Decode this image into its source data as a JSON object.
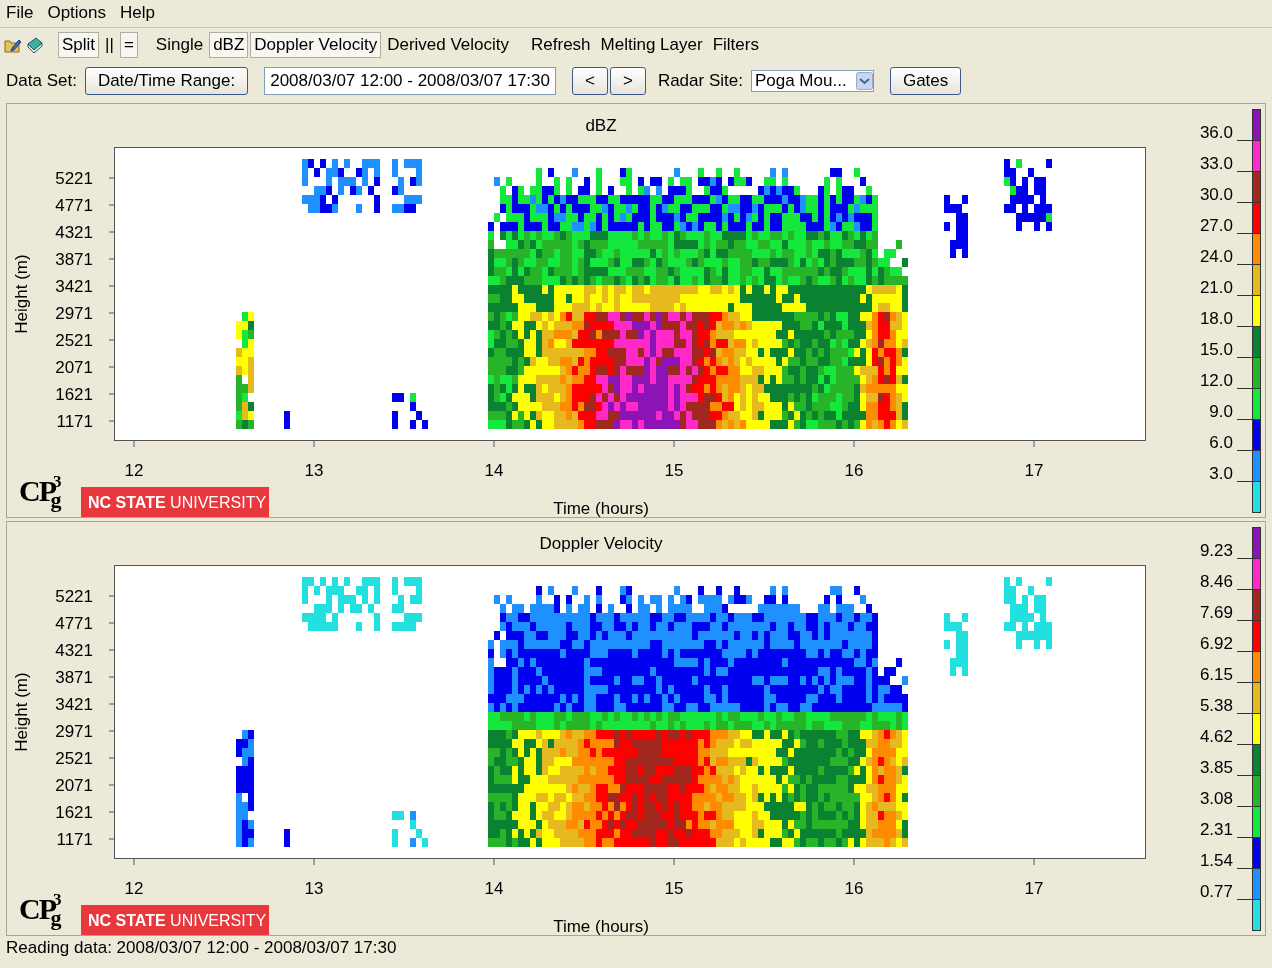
{
  "menu": [
    {
      "label": "File"
    },
    {
      "label": "Options"
    },
    {
      "label": "Help"
    }
  ],
  "toolbar": {
    "items": [
      {
        "label": "Split",
        "selected": true
      },
      {
        "label": "||",
        "selected": false
      },
      {
        "label": "=",
        "selected": true
      },
      {
        "label": "Single",
        "selected": false
      },
      {
        "label": "dBZ",
        "selected": true
      },
      {
        "label": "Doppler Velocity",
        "selected": true
      },
      {
        "label": "Derived Velocity",
        "selected": false
      },
      {
        "label": "Refresh",
        "selected": false
      },
      {
        "label": "Melting Layer",
        "selected": false
      },
      {
        "label": "Filters",
        "selected": false
      }
    ]
  },
  "dataset": {
    "label": "Data Set:",
    "range_button": "Date/Time Range:",
    "range_value": "2008/03/07 12:00 - 2008/03/07 17:30",
    "prev_button": "<",
    "next_button": ">",
    "site_label": "Radar Site:",
    "site_value": "Poga Mou...",
    "gates_button": "Gates"
  },
  "panels": [
    {
      "title": "dBZ",
      "kind": "reflectivity",
      "ylabel": "Height (m)",
      "yticks": [
        "5221",
        "4771",
        "4321",
        "3871",
        "3421",
        "2971",
        "2521",
        "2071",
        "1621",
        "1171"
      ],
      "xticks": [
        "12",
        "13",
        "14",
        "15",
        "16",
        "17"
      ],
      "xlabel": "Time (hours)",
      "logo": {
        "main": "CP",
        "sup": "3",
        "sub": "g"
      },
      "badge": {
        "bold": "NC STATE",
        "light": "UNIVERSITY"
      },
      "legend": {
        "labels": [
          "36.0",
          "33.0",
          "30.0",
          "27.0",
          "24.0",
          "21.0",
          "18.0",
          "15.0",
          "12.0",
          "9.0",
          "6.0",
          "3.0"
        ],
        "bands": [
          {
            "color": "#8c14b4"
          },
          {
            "color": "#ff28c8"
          },
          {
            "color": "#a0281e"
          },
          {
            "color": "#ff0000"
          },
          {
            "color": "#ff8c00"
          },
          {
            "color": "#e6b91e"
          },
          {
            "color": "#ffff00"
          },
          {
            "color": "#0a8232"
          },
          {
            "color": "#28b428"
          },
          {
            "color": "#14e83c"
          },
          {
            "color": "#0000f0"
          },
          {
            "color": "#1e90ff"
          },
          {
            "color": "#22e0e0"
          }
        ]
      }
    },
    {
      "title": "Doppler Velocity",
      "kind": "velocity",
      "ylabel": "Height (m)",
      "yticks": [
        "5221",
        "4771",
        "4321",
        "3871",
        "3421",
        "2971",
        "2521",
        "2071",
        "1621",
        "1171"
      ],
      "xticks": [
        "12",
        "13",
        "14",
        "15",
        "16",
        "17"
      ],
      "xlabel": "Time (hours)",
      "logo": {
        "main": "CP",
        "sup": "3",
        "sub": "g"
      },
      "badge": {
        "bold": "NC STATE",
        "light": "UNIVERSITY"
      },
      "legend": {
        "labels": [
          "9.23",
          "8.46",
          "7.69",
          "6.92",
          "6.15",
          "5.38",
          "4.62",
          "3.85",
          "3.08",
          "2.31",
          "1.54",
          "0.77"
        ],
        "bands": [
          {
            "color": "#8c14b4"
          },
          {
            "color": "#ff28c8"
          },
          {
            "color": "#a0281e"
          },
          {
            "color": "#ff0000"
          },
          {
            "color": "#ff8c00"
          },
          {
            "color": "#e6b91e"
          },
          {
            "color": "#ffff00"
          },
          {
            "color": "#0a8232"
          },
          {
            "color": "#28b428"
          },
          {
            "color": "#14e83c"
          },
          {
            "color": "#0000f0"
          },
          {
            "color": "#1e90ff"
          },
          {
            "color": "#22e0e0"
          }
        ]
      }
    }
  ],
  "status_bar": "Reading data: 2008/03/07 12:00 - 2008/03/07 17:30"
}
